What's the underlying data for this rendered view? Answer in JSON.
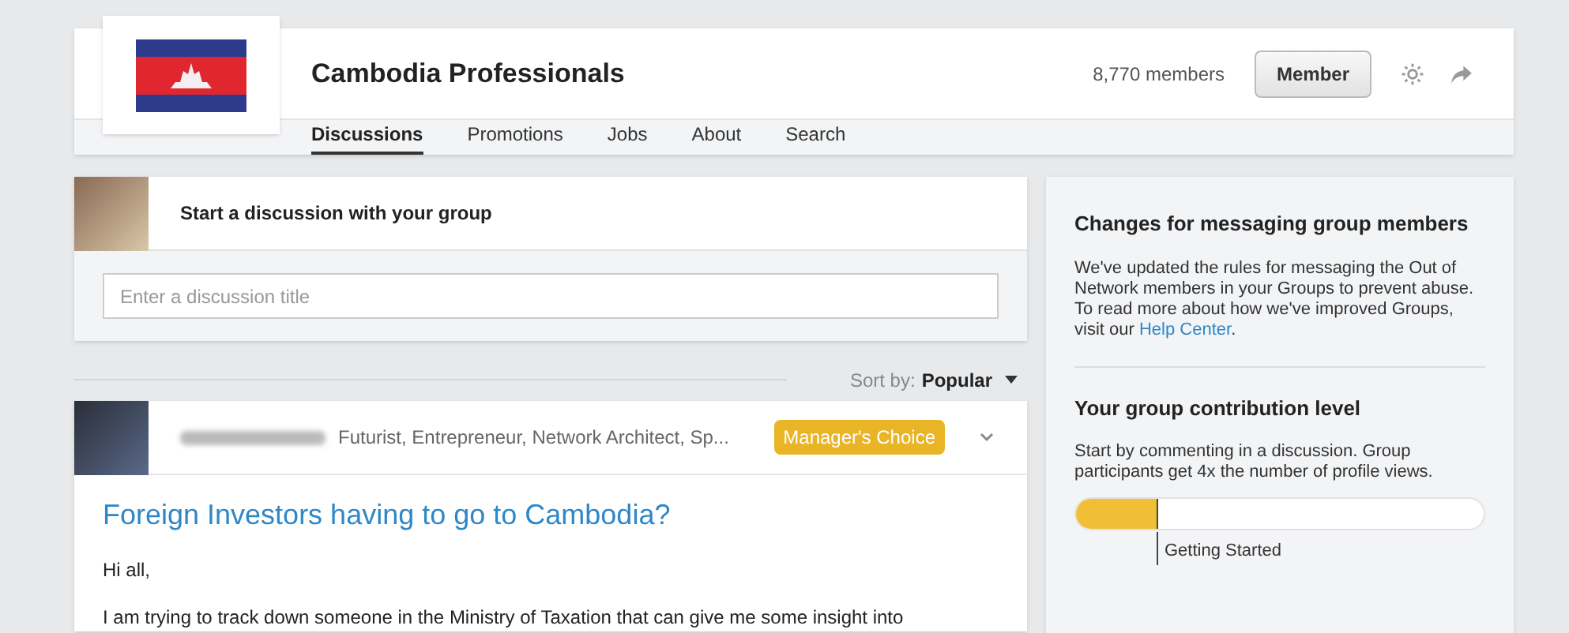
{
  "group": {
    "name": "Cambodia Professionals",
    "members": "8,770 members",
    "member_button": "Member"
  },
  "tabs": [
    {
      "label": "Discussions",
      "selected": true
    },
    {
      "label": "Promotions",
      "selected": false
    },
    {
      "label": "Jobs",
      "selected": false
    },
    {
      "label": "About",
      "selected": false
    },
    {
      "label": "Search",
      "selected": false
    }
  ],
  "composer": {
    "prompt": "Start a discussion with your group",
    "placeholder": "Enter a discussion title"
  },
  "sort": {
    "label": "Sort by:",
    "value": "Popular"
  },
  "post": {
    "headline": "Futurist, Entrepreneur, Network Architect, Sp...",
    "badge": "Manager's Choice",
    "title": "Foreign Investors having to go to Cambodia?",
    "paragraphs": [
      "Hi all,",
      "I am trying to track down someone in the Ministry of Taxation that can give me some insight into"
    ]
  },
  "notice": {
    "title": "Changes for messaging group members",
    "text": "We've updated the rules for messaging the Out of Network members in your Groups to prevent abuse. To read more about how we've improved Groups, visit our",
    "link": "Help Center",
    "end": "."
  },
  "contribution": {
    "title": "Your group contribution level",
    "text": "Start by commenting in a discussion. Group participants get 4x the number of profile views.",
    "level": 0.2,
    "stage": "Getting Started"
  }
}
